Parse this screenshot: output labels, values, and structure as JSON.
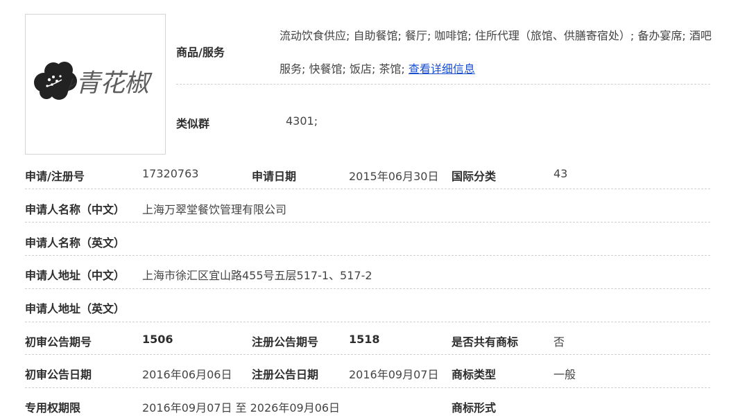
{
  "logo": {
    "alt_text": "青花椒",
    "icon": "plum-blossom-cloud-icon"
  },
  "goods": {
    "label": "商品/服务",
    "text": "流动饮食供应; 自助餐馆; 餐厅; 咖啡馆; 住所代理（旅馆、供膳寄宿处）; 备办宴席; 酒吧服务; 快餐馆; 饭店; 茶馆; ",
    "detail_link": "查看详细信息"
  },
  "similar_group": {
    "label": "类似群",
    "value": "4301;"
  },
  "rows": {
    "reg": {
      "l1": "申请/注册号",
      "v1": "17320763",
      "l2": "申请日期",
      "v2": "2015年06月30日",
      "l3": "国际分类",
      "v3": "43"
    },
    "applicant_cn": {
      "l1": "申请人名称（中文）",
      "v1": "上海万翠堂餐饮管理有限公司"
    },
    "applicant_en": {
      "l1": "申请人名称（英文）",
      "v1": ""
    },
    "address_cn": {
      "l1": "申请人地址（中文）",
      "v1": "上海市徐汇区宜山路455号五层517-1、517-2"
    },
    "address_en": {
      "l1": "申请人地址（英文）",
      "v1": ""
    },
    "pub_no": {
      "l1": "初审公告期号",
      "v1": "1506",
      "l2": "注册公告期号",
      "v2": "1518",
      "l3": "是否共有商标",
      "v3": "否"
    },
    "pub_date": {
      "l1": "初审公告日期",
      "v1": "2016年06月06日",
      "l2": "注册公告日期",
      "v2": "2016年09月07日",
      "l3": "商标类型",
      "v3": "一般"
    },
    "term": {
      "l1": "专用权期限",
      "v1": "2016年09月07日 至 2026年09月06日",
      "l3": "商标形式",
      "v3": ""
    }
  }
}
